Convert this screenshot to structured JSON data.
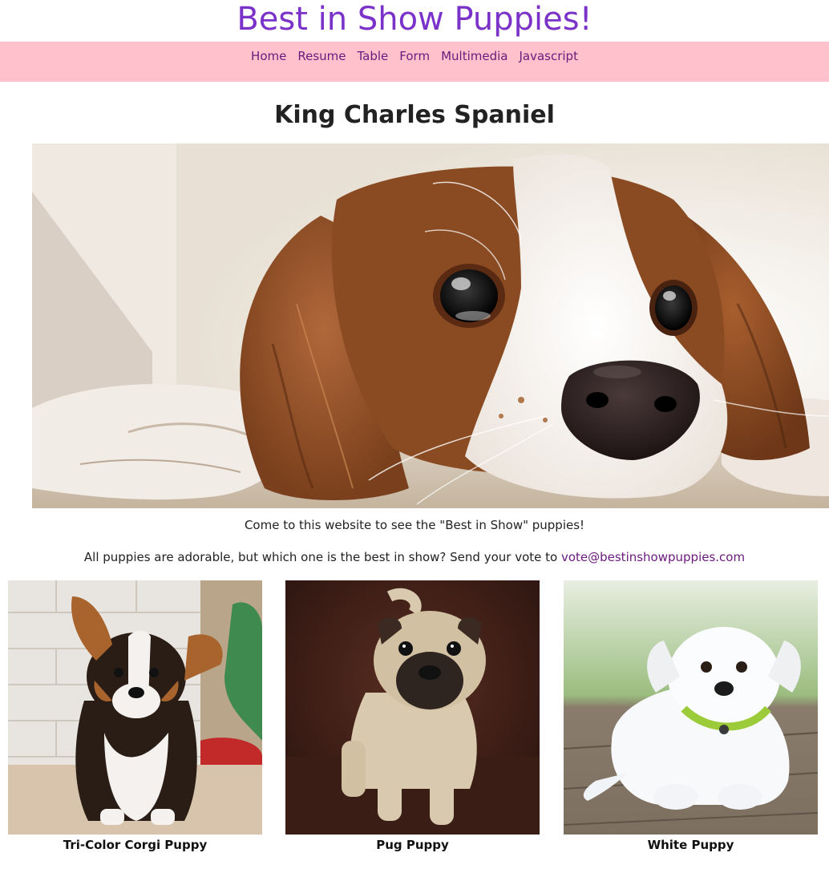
{
  "header": {
    "title": "Best in Show Puppies!"
  },
  "nav": {
    "items": [
      {
        "label": "Home"
      },
      {
        "label": "Resume"
      },
      {
        "label": "Table"
      },
      {
        "label": "Form"
      },
      {
        "label": "Multimedia"
      },
      {
        "label": "Javascript"
      }
    ]
  },
  "main": {
    "heading": "King Charles Spaniel",
    "intro": "Come to this website to see the \"Best in Show\" puppies!",
    "vote_text": "All puppies are adorable, but which one is the best in show? Send your vote to ",
    "vote_email": "vote@bestinshowpuppies.com"
  },
  "gallery": [
    {
      "caption": "Tri-Color Corgi Puppy"
    },
    {
      "caption": "Pug Puppy"
    },
    {
      "caption": "White Puppy"
    }
  ],
  "colors": {
    "title": "#7a32c8",
    "nav_background": "#ffc1cc",
    "link": "#6a1a7c"
  }
}
